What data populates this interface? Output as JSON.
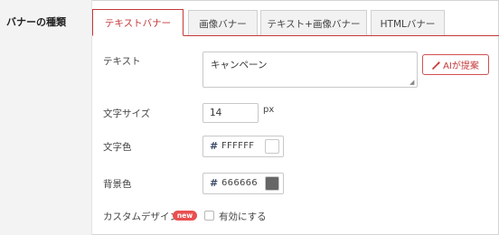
{
  "section": {
    "label": "バナーの種類"
  },
  "tabs": [
    {
      "label": "テキストバナー",
      "active": true
    },
    {
      "label": "画像バナー",
      "active": false
    },
    {
      "label": "テキスト+画像バナー",
      "active": false
    },
    {
      "label": "HTMLバナー",
      "active": false
    }
  ],
  "text_row": {
    "label": "テキスト",
    "value": "キャンペーン",
    "ai_button_label": "AIが提案",
    "ai_icon": "magic-wand-icon"
  },
  "font_size_row": {
    "label": "文字サイズ",
    "value": "14",
    "unit": "px"
  },
  "text_color_row": {
    "label": "文字色",
    "hash": "#",
    "value": "FFFFFF",
    "swatch_color": "#FFFFFF"
  },
  "bg_color_row": {
    "label": "背景色",
    "hash": "#",
    "value": "666666",
    "swatch_color": "#666666"
  },
  "custom_design_row": {
    "label": "カスタムデザイン",
    "badge": "new",
    "checkbox_label": "有効にする",
    "checked": false
  },
  "colors": {
    "accent": "#c43838",
    "badge": "#e94f4f"
  }
}
